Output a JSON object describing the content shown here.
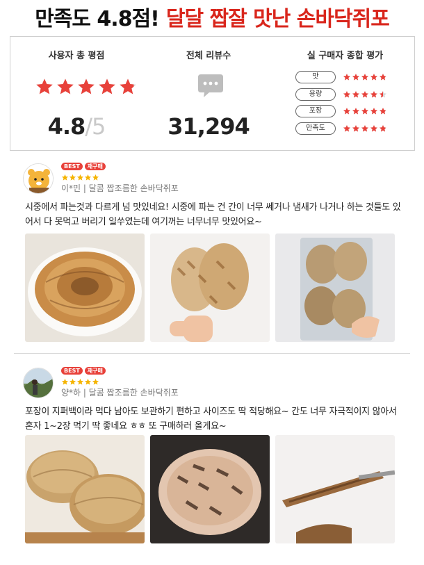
{
  "headline": {
    "part1": "만족도 4.8점!",
    "part2": "달달 짭잘 맛난 손바닥쥐포",
    "colors": {
      "black": "#111111",
      "red": "#d9261c"
    }
  },
  "summary": {
    "rating": {
      "title": "사용자 총 평점",
      "value": "4.8",
      "max": "/5",
      "stars_filled": 4.8
    },
    "reviews": {
      "title": "전체 리뷰수",
      "icon": "chat-bubble-icon",
      "count": "31,294"
    },
    "evaluation": {
      "title": "실 구매자 종합 평가",
      "items": [
        {
          "label": "맛",
          "stars": 4.8
        },
        {
          "label": "용량",
          "stars": 4.5
        },
        {
          "label": "포장",
          "stars": 4.8
        },
        {
          "label": "만족도",
          "stars": 4.8
        }
      ]
    },
    "star_color": "#e8413a"
  },
  "reviews": [
    {
      "badges": [
        "BEST",
        "재구매"
      ],
      "stars": 5,
      "author": "이*민",
      "product": "달콤 짭조름한 손바닥쥐포",
      "meta": "이*민 | 달콤 짭조름한 손바닥쥐포",
      "text": "시중에서 파는것과 다르게 넘 맛있네요! 시중에 파는 건 간이 너무 쎄거나 냄새가 나거나 하는 것들도 있어서 다 못먹고 버리기 일쑤였는데 여기꺼는 너무너무 맛있어요~",
      "photos": [
        "fish-snack-stack-photo",
        "heart-shaped-snack-photo",
        "packaged-snack-photo"
      ]
    },
    {
      "badges": [
        "BEST",
        "재구매"
      ],
      "stars": 5,
      "author": "양*하",
      "product": "달콤 짭조름한 손바닥쥐포",
      "meta": "양*하 | 달콤 짭조름한 손바닥쥐포",
      "text": "포장이 지퍼백이라 먹다 남아도 보관하기 편하고 사이즈도 딱 적당해요~ 간도 너무 자극적이지 않아서 혼자 1~2장 먹기 딱 좋네요 ㅎㅎ 또 구매하러 올게요~",
      "photos": [
        "snack-pile-photo",
        "grilled-snack-photo",
        "tongs-snack-photo"
      ]
    }
  ]
}
